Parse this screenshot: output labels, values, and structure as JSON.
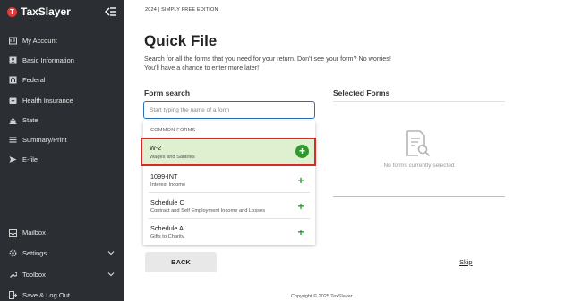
{
  "app": {
    "brand": "TaxSlayer",
    "logo_mark": "T"
  },
  "sidebar": {
    "collapse_icon": "collapse-menu-icon",
    "items": [
      {
        "label": "My Account",
        "icon": "id-card-icon"
      },
      {
        "label": "Basic Information",
        "icon": "person-icon"
      },
      {
        "label": "Federal",
        "icon": "bank-icon"
      },
      {
        "label": "Health Insurance",
        "icon": "first-aid-icon"
      },
      {
        "label": "State",
        "icon": "capitol-icon"
      },
      {
        "label": "Summary/Print",
        "icon": "summary-icon"
      },
      {
        "label": "E-file",
        "icon": "send-icon"
      }
    ],
    "bottom_items": [
      {
        "label": "Mailbox",
        "icon": "mailbox-icon"
      },
      {
        "label": "Settings",
        "icon": "gear-icon"
      },
      {
        "label": "Toolbox",
        "icon": "toolbox-icon"
      },
      {
        "label": "Save & Log Out",
        "icon": "logout-icon"
      }
    ]
  },
  "main": {
    "edition": "2024 | SIMPLY FREE EDITION",
    "title": "Quick File",
    "description_line1": "Search for all the forms that you need for your return. Don't see your form? No worries!",
    "description_line2": "You'll have a chance to enter more later!",
    "form_search_label": "Form search",
    "search_placeholder": "Start typing the name of a form",
    "search_value": "",
    "selected_forms_label": "Selected Forms",
    "common_forms_label": "COMMON FORMS",
    "forms": [
      {
        "title": "W-2",
        "subtitle": "Wages and Salaries"
      },
      {
        "title": "1099-INT",
        "subtitle": "Interest Income"
      },
      {
        "title": "Schedule C",
        "subtitle": "Contract and Self Employment Income and Losses"
      },
      {
        "title": "Schedule A",
        "subtitle": "Gifts to Charity"
      }
    ],
    "empty_selected_text": "No forms currently selected",
    "back_label": "BACK",
    "skip_label": "Skip",
    "copyright": "Copyright © 2025 TaxSlayer"
  },
  "colors": {
    "sidebar_bg": "#2b2f33",
    "accent_green": "#2e9a2e",
    "highlight_bg": "#dff0d0",
    "highlight_border": "#d42b2b",
    "input_border": "#2b6fb8"
  }
}
